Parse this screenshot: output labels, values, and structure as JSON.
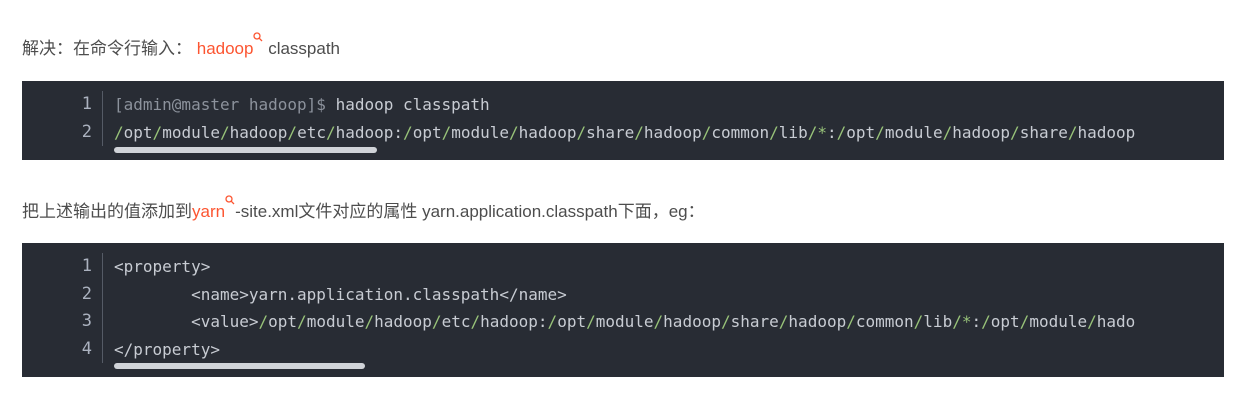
{
  "para1": {
    "prefix": "解决：在命令行输入： ",
    "keyword": "hadoop",
    "suffix": " classpath"
  },
  "code1": {
    "line_numbers": [
      "1",
      "2"
    ],
    "prompt": "[admin@master hadoop]$ ",
    "command": "hadoop classpath",
    "output": "/opt/module/hadoop/etc/hadoop:/opt/module/hadoop/share/hadoop/common/lib/*:/opt/module/hadoop/share/hadoop"
  },
  "para2": {
    "prefix": "把上述输出的值添加到",
    "keyword": "yarn",
    "suffix": "-site.xml文件对应的属性 yarn.application.classpath下面，eg："
  },
  "code2": {
    "line_numbers": [
      "1",
      "2",
      "3",
      "4"
    ],
    "lines": [
      "<property>",
      "        <name>yarn.application.classpath</name>",
      "        <value>/opt/module/hadoop/etc/hadoop:/opt/module/hadoop/share/hadoop/common/lib/*:/opt/module/hado",
      "</property>"
    ]
  },
  "colors": {
    "keyword": "#fc5531",
    "code_bg": "#282c34",
    "path_sep": "#98c379"
  }
}
